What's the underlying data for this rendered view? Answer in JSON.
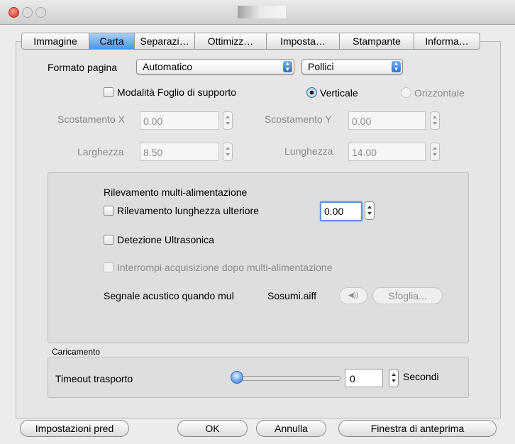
{
  "tabs": [
    "Immagine",
    "Carta",
    "Separazi…",
    "Ottimizz…",
    "Imposta…",
    "Stampante",
    "Informa…"
  ],
  "active_tab": "Carta",
  "paper": {
    "format_label": "Formato pagina",
    "format_value": "Automatico",
    "unit_value": "Pollici",
    "carrier_label": "Modalità Foglio di supporto",
    "orientation_portrait": "Verticale",
    "orientation_landscape": "Orizzontale",
    "offset_x_label": "Scostamento X",
    "offset_x_value": "0.00",
    "offset_y_label": "Scostamento Y",
    "offset_y_value": "0.00",
    "width_label": "Larghezza",
    "width_value": "8.50",
    "length_label": "Lunghezza",
    "length_value": "14.00"
  },
  "multifeed": {
    "title": "Rilevamento multi-alimentazione",
    "length_label": "Rilevamento lunghezza ulteriore",
    "length_value": "0.00",
    "ultrasonic_label": "Detezione Ultrasonica",
    "stop_label": "Interrompi acquisizione dopo multi-alimentazione",
    "beep_label": "Segnale acustico quando mul",
    "beep_file": "Sosumi.aiff",
    "speaker_glyph": "◀))",
    "browse_label": "Sfoglia..."
  },
  "loading": {
    "group_label": "Caricamento",
    "timeout_label": "Timeout trasporto",
    "timeout_value": "0",
    "unit_label": "Secondi",
    "slider_fraction": 0
  },
  "buttons": {
    "defaults": "Impostazioni pred",
    "ok": "OK",
    "cancel": "Annulla",
    "preview": "Finestra di anteprima"
  }
}
